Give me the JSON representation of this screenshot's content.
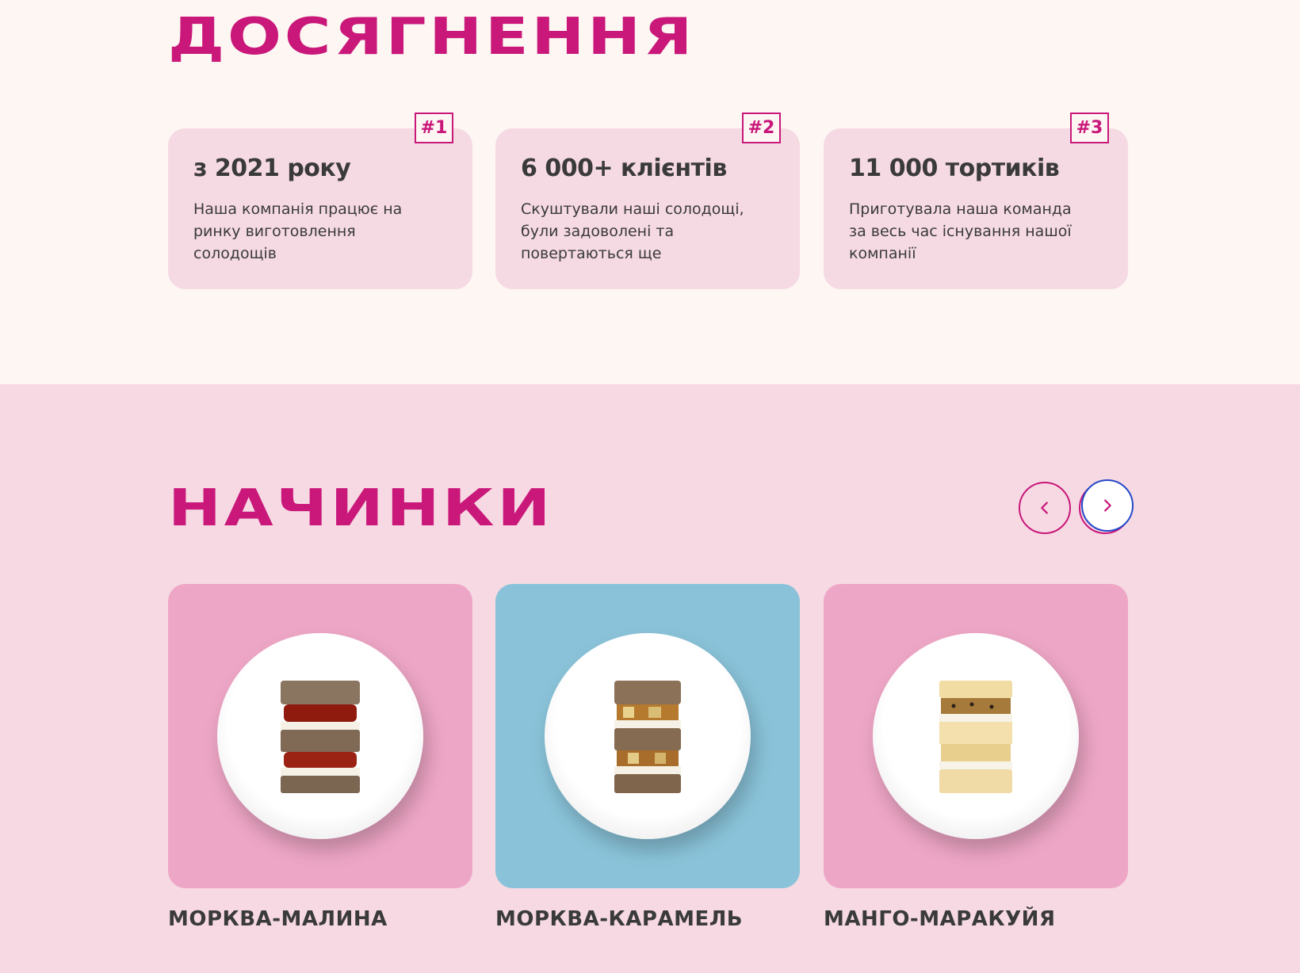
{
  "achievements": {
    "title": "ДОСЯГНЕННЯ",
    "cards": [
      {
        "badge": "#1",
        "heading": "з 2021 року",
        "text": "Наша компанія працює на ринку виготовлення солодощів"
      },
      {
        "badge": "#2",
        "heading": "6 000+ клієнтів",
        "text": "Скуштували наші солодощі, були задоволені та повертаються ще"
      },
      {
        "badge": "#3",
        "heading": "11 000 тортиків",
        "text": "Приготувала наша команда за весь час існування нашої компанії"
      }
    ]
  },
  "fillings": {
    "title": "НАЧИНКИ",
    "prev_icon": "chevron-left-icon",
    "next_icon": "chevron-right-icon",
    "items": [
      {
        "name": "МОРКВА-МАЛИНА",
        "bg": "#eea6c6",
        "image": "carrot-raspberry-cake-slice"
      },
      {
        "name": "МОРКВА-КАРАМЕЛЬ",
        "bg": "#8ac3d9",
        "image": "carrot-caramel-cake-slice"
      },
      {
        "name": "МАНГО-МАРАКУЙЯ",
        "bg": "#eea6c6",
        "image": "mango-passionfruit-cake-slice"
      }
    ]
  },
  "colors": {
    "accent": "#c9177a",
    "page_bg": "#fdf6f2",
    "section_bg": "#f6d9e3",
    "card_bg": "#f5d9e3",
    "focus_ring": "#2449c9"
  }
}
